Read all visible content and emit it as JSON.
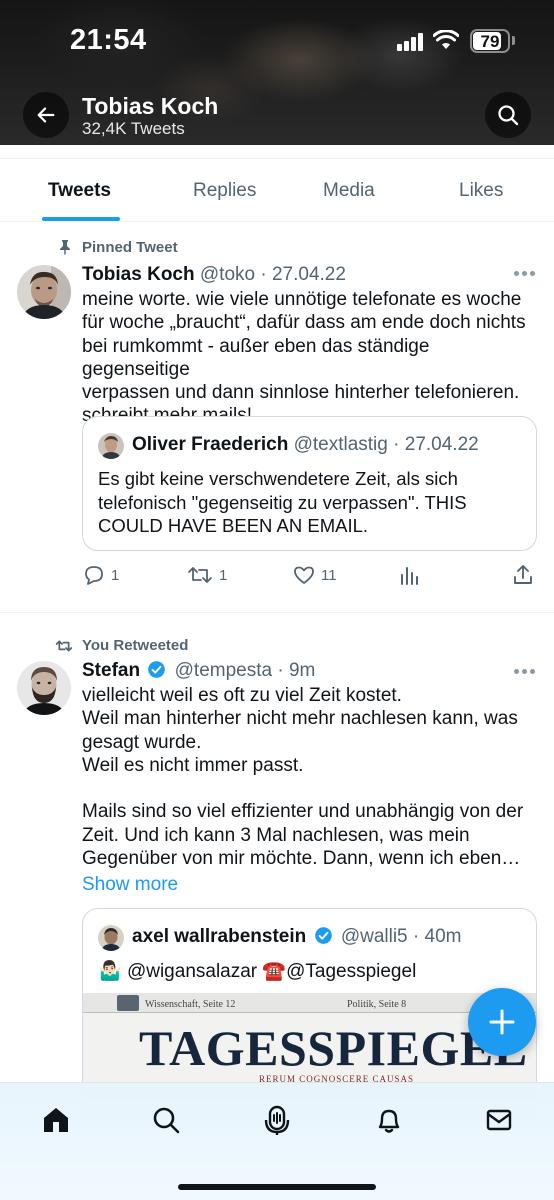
{
  "status_bar": {
    "time": "21:54",
    "battery": "79"
  },
  "header": {
    "name": "Tobias Koch",
    "tweet_count": "32,4K Tweets"
  },
  "tabs": [
    {
      "label": "Tweets",
      "active": true
    },
    {
      "label": "Replies",
      "active": false
    },
    {
      "label": "Media",
      "active": false
    },
    {
      "label": "Likes",
      "active": false
    }
  ],
  "tweets": [
    {
      "context": "Pinned Tweet",
      "author": "Tobias Koch",
      "handle": "@toko",
      "date": "27.04.22",
      "text": "meine worte. wie viele unnötige telefonate es woche\nfür woche „braucht“, dafür dass am ende doch nichts\nbei rumkommt - außer eben das ständige gegenseitige\nverpassen und dann sinnlose hinterher telefonieren.\nschreibt mehr mails!",
      "quote": {
        "author": "Oliver Fraederich",
        "handle": "@textlastig",
        "date": "27.04.22",
        "text": "Es gibt keine verschwendetere Zeit, als sich telefonisch \"gegenseitig zu verpassen\". THIS COULD HAVE BEEN AN EMAIL."
      },
      "replies": "1",
      "retweets": "1",
      "likes": "11"
    },
    {
      "context": "You Retweeted",
      "author": "Stefan",
      "handle": "@tempesta",
      "date": "9m",
      "text": "vielleicht weil es oft zu viel Zeit kostet.\nWeil man hinterher nicht mehr nachlesen kann, was\ngesagt wurde.\nWeil es nicht immer passt.\n\nMails sind so viel effizienter und unabhängig von der\nZeit. Und ich kann 3 Mal nachlesen, was mein\nGegenüber von mir möchte. Dann, wenn ich eben…",
      "show_more": "Show more",
      "quote": {
        "author": "axel wallrabenstein",
        "handle": "@walli5",
        "date": "40m",
        "emoji_1": "🤷🏻‍♂️",
        "mention_1": "@wigansalazar",
        "emoji_2": "☎️",
        "mention_2": "@Tagesspiegel",
        "image_title": "TAGESSPIEGEL",
        "image_motto": "RERUM COGNOSCERE CAUSAS",
        "image_left_tag": "Wissenschaft, Seite 12",
        "image_right_tag": "Politik, Seite 8"
      }
    }
  ],
  "bottom_nav": [
    "home-icon",
    "search-icon",
    "spaces-icon",
    "notifications-icon",
    "messages-icon"
  ],
  "colors": {
    "accent": "#1d9bf0",
    "text": "#0f1419",
    "secondary": "#536471",
    "border": "#cfd9de"
  }
}
